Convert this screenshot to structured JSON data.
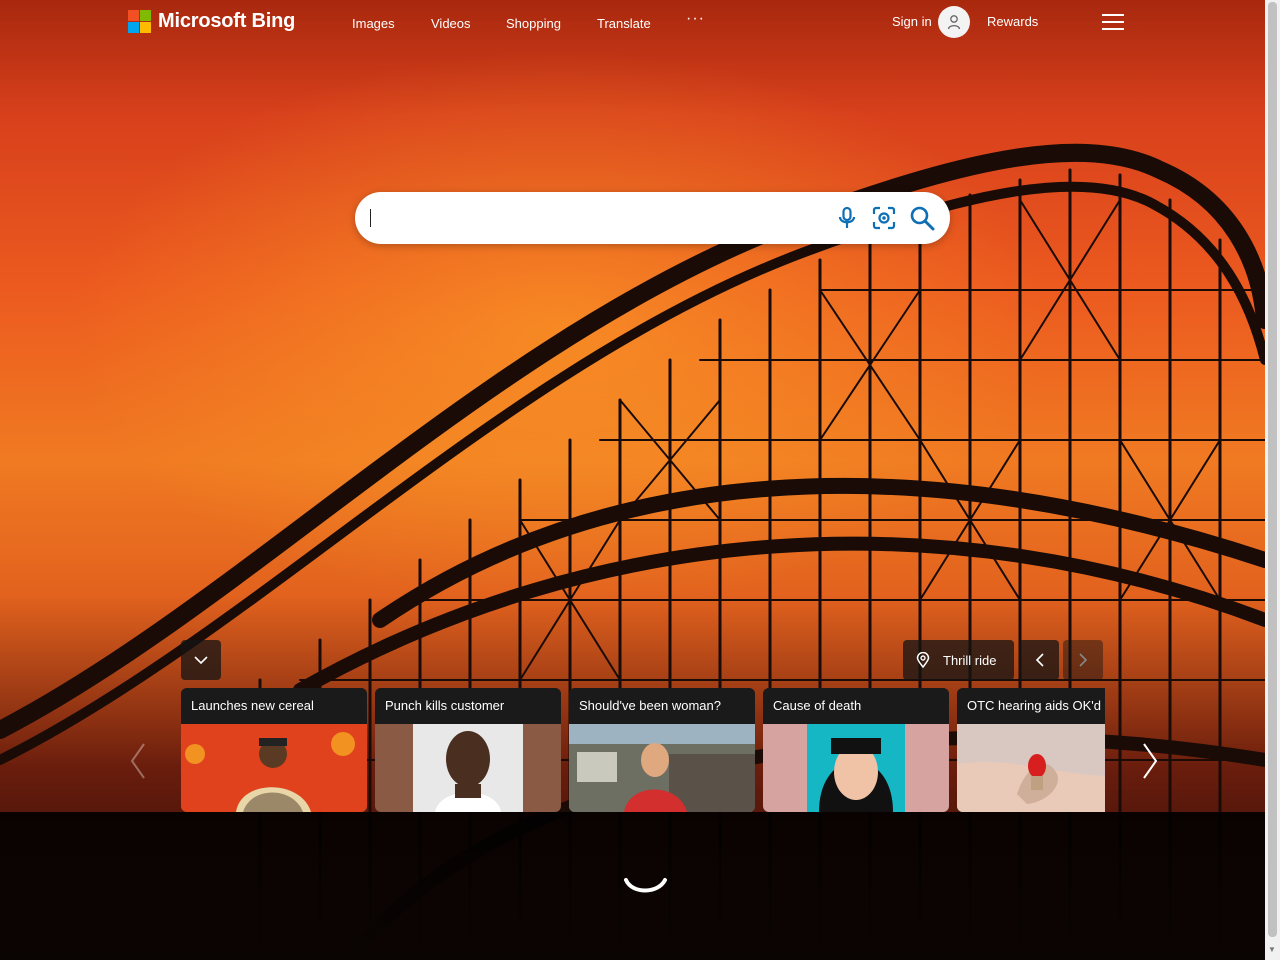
{
  "brand": {
    "name": "Microsoft Bing",
    "logo_colors": [
      "#f25022",
      "#7fba00",
      "#00a4ef",
      "#ffb900"
    ]
  },
  "nav": {
    "items": [
      "Images",
      "Videos",
      "Shopping",
      "Translate"
    ],
    "more_label": "···"
  },
  "account": {
    "sign_in_label": "Sign in",
    "rewards_label": "Rewards"
  },
  "search": {
    "placeholder": "",
    "value": "",
    "mic_icon": "microphone-icon",
    "visual_search_icon": "visual-search-icon",
    "search_icon": "search-icon",
    "accent_color": "#0e6fb5"
  },
  "image_of_day": {
    "location_label": "Thrill ride"
  },
  "carousel": {
    "cards": [
      {
        "title": "Launches new cereal",
        "icon": "news-thumbnail"
      },
      {
        "title": "Punch kills customer",
        "icon": "news-thumbnail"
      },
      {
        "title": "Should've been woman?",
        "icon": "news-thumbnail"
      },
      {
        "title": "Cause of death",
        "icon": "news-thumbnail"
      },
      {
        "title": "OTC hearing aids OK'd",
        "icon": "news-thumbnail"
      }
    ]
  }
}
